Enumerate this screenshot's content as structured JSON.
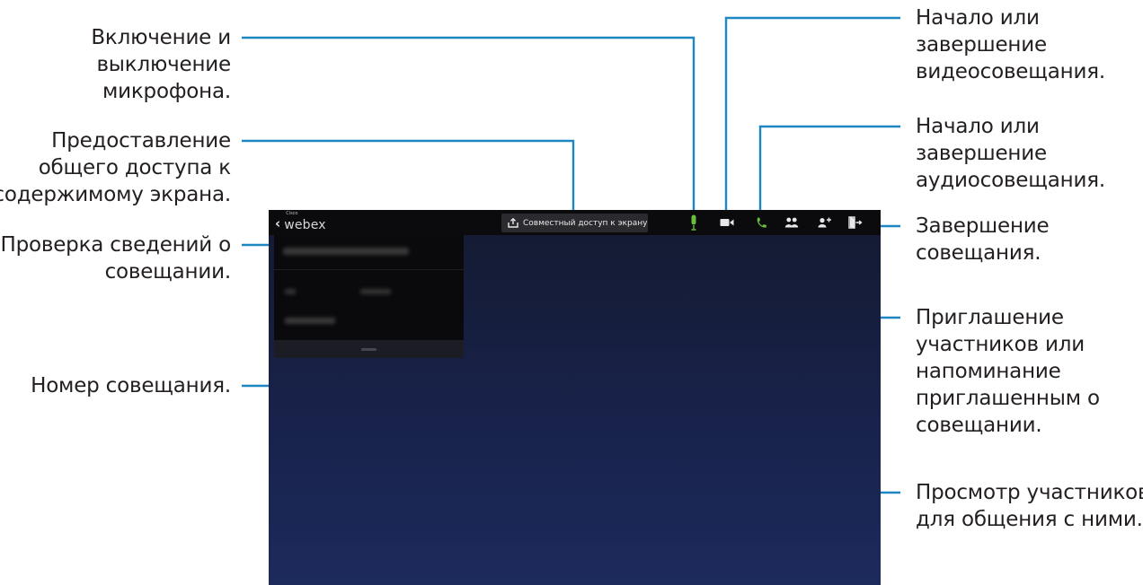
{
  "callouts": {
    "mic": [
      "Включение и",
      "выключение",
      "микрофона."
    ],
    "share": [
      "Предоставление",
      "общего доступа к",
      "содержимому экрана."
    ],
    "info": [
      "Проверка сведений о",
      "совещании."
    ],
    "number": [
      "Номер совещания."
    ],
    "video": [
      "Начало или",
      "завершение",
      "видеосовещания."
    ],
    "audio": [
      "Начало или",
      "завершение",
      "аудиосовещания."
    ],
    "end": [
      "Завершение",
      "совещания."
    ],
    "invite": [
      "Приглашение",
      "участников или",
      "напоминание",
      "приглашенным о",
      "совещании."
    ],
    "participants": [
      "Просмотр участников",
      "для общения с ними."
    ]
  },
  "app": {
    "logo_small": "Cisco",
    "logo_main": "webex",
    "share_button_label": "Совместный доступ к экрану"
  },
  "icons": {
    "back": "chevron-left-icon",
    "share": "share-upload-icon",
    "mic": "microphone-icon",
    "video": "video-camera-icon",
    "audio": "phone-icon",
    "participants": "people-icon",
    "invite": "add-person-icon",
    "leave": "exit-door-icon"
  },
  "colors": {
    "leader_line": "#1e86c2",
    "mic": "#6abf3a",
    "phone": "#6abf3a",
    "icon_default": "#e8e8e8",
    "actionbar": "#0b0b0e"
  }
}
